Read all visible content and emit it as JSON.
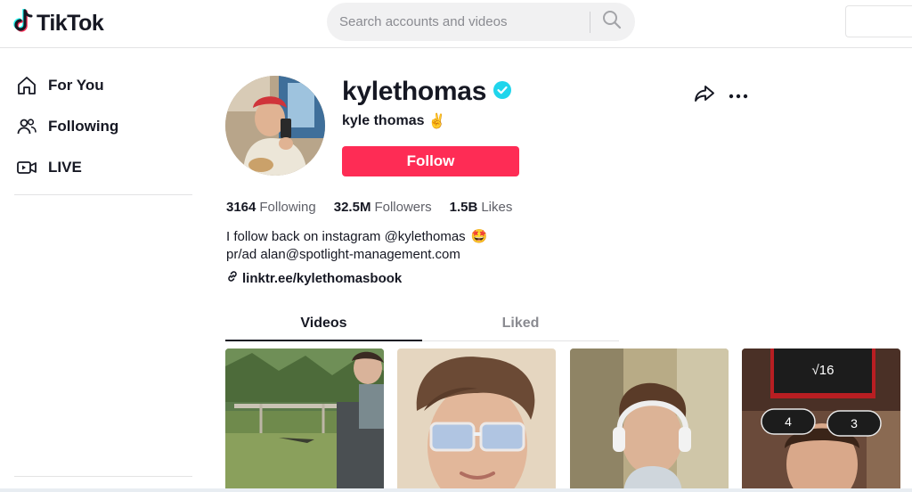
{
  "header": {
    "logo_text": "TikTok",
    "search_placeholder": "Search accounts and videos"
  },
  "sidebar": {
    "items": [
      {
        "label": "For You",
        "icon": "home-icon"
      },
      {
        "label": "Following",
        "icon": "users-icon"
      },
      {
        "label": "LIVE",
        "icon": "live-icon"
      }
    ]
  },
  "profile": {
    "username": "kylethomas",
    "verified": true,
    "display_name": "kyle thomas",
    "display_name_emoji": "✌️",
    "follow_label": "Follow",
    "stats": [
      {
        "value": "3164",
        "label": "Following"
      },
      {
        "value": "32.5M",
        "label": "Followers"
      },
      {
        "value": "1.5B",
        "label": "Likes"
      }
    ],
    "bio": [
      {
        "text": "I follow back on instagram @kylethomas",
        "emoji": "🤩"
      },
      {
        "text": "pr/ad alan@spotlight-management.com",
        "emoji": ""
      }
    ],
    "link": "linktr.ee/kylethomasbook"
  },
  "tabs": [
    {
      "label": "Videos",
      "active": true
    },
    {
      "label": "Liked",
      "active": false
    }
  ],
  "videos": [
    {
      "thumb": "crocodile-pond"
    },
    {
      "thumb": "blue-light-glasses"
    },
    {
      "thumb": "headphones-portrait"
    },
    {
      "thumb": "math-quiz-filter",
      "overlay_text": "√16",
      "options": [
        "4",
        "3"
      ]
    }
  ],
  "colors": {
    "accent": "#fe2c55",
    "verified": "#20d5ec",
    "text": "#161823"
  }
}
